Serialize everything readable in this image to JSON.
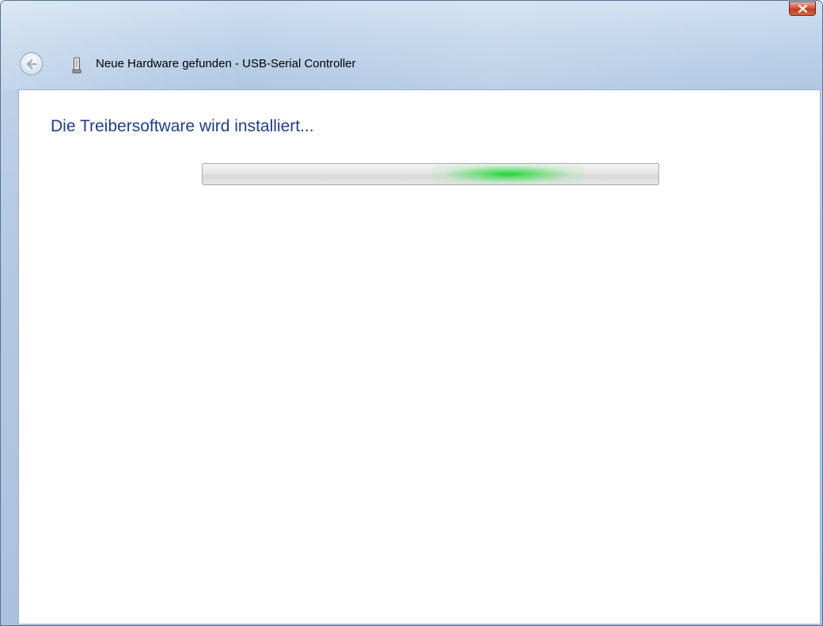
{
  "window": {
    "title": "Neue Hardware gefunden - USB-Serial Controller",
    "close_icon": "close-icon",
    "back_icon": "back-arrow-icon",
    "device_icon": "usb-device-icon"
  },
  "main": {
    "heading": "Die Treibersoftware wird installiert...",
    "progress": {
      "mode": "indeterminate",
      "highlight_position": 0.67,
      "highlight_color": "#1fd635"
    }
  },
  "colors": {
    "heading": "#1e3d8c",
    "titlebar": "#bed3ea",
    "close_button": "#c23a20"
  }
}
